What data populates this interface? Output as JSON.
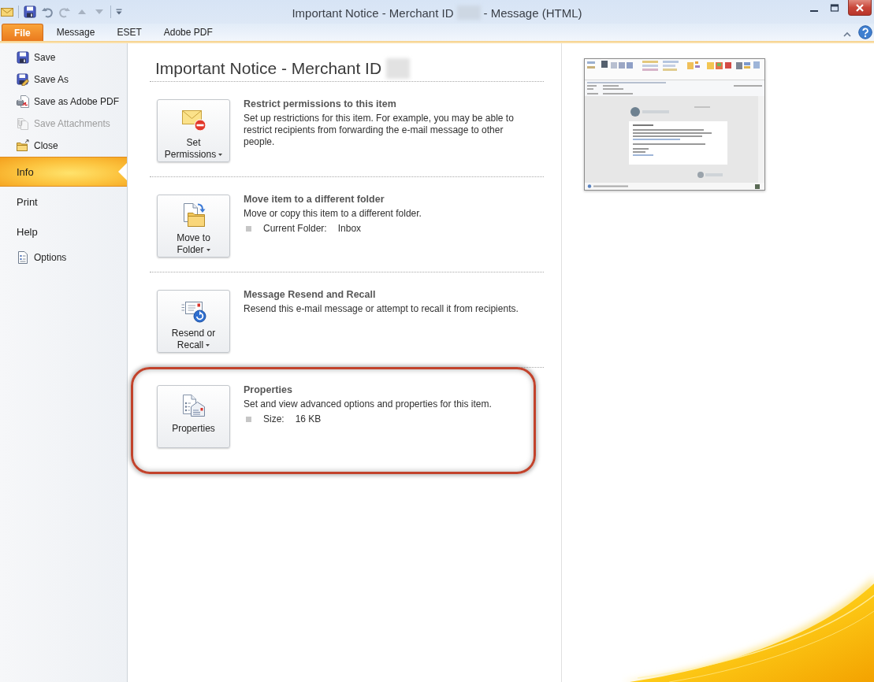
{
  "window": {
    "title_start": "Important Notice - Merchant ID",
    "id_redacted": true,
    "title_end": "- Message (HTML)"
  },
  "ribbon_tabs": [
    {
      "label": "File",
      "selected": true
    },
    {
      "label": "Message",
      "selected": false
    },
    {
      "label": "ESET",
      "selected": false
    },
    {
      "label": "Adobe PDF",
      "selected": false
    }
  ],
  "backstage_nav": [
    {
      "kind": "command",
      "label": "Save",
      "selected": false,
      "disabled": false
    },
    {
      "kind": "command",
      "label": "Save As",
      "selected": false,
      "disabled": false
    },
    {
      "kind": "command",
      "label": "Save as Adobe PDF",
      "selected": false,
      "disabled": false
    },
    {
      "kind": "command",
      "label": "Save Attachments",
      "selected": false,
      "disabled": true
    },
    {
      "kind": "command",
      "label": "Close",
      "selected": false,
      "disabled": false
    },
    {
      "kind": "tab",
      "label": "Info",
      "selected": true,
      "disabled": false
    },
    {
      "kind": "tab",
      "label": "Print",
      "selected": false,
      "disabled": false
    },
    {
      "kind": "tab",
      "label": "Help",
      "selected": false,
      "disabled": false
    },
    {
      "kind": "command",
      "label": "Options",
      "selected": false,
      "disabled": false
    }
  ],
  "info": {
    "title": "Important Notice - Merchant ID",
    "id_redacted": true,
    "sections": [
      {
        "heading": "Restrict permissions to this item",
        "description": "Set up restrictions for this item. For example, you may be able to restrict recipients from forwarding the e-mail message to other people.",
        "button": {
          "label": "Set Permissions",
          "dropdown": true
        },
        "highlighted": false
      },
      {
        "heading": "Move item to a different folder",
        "description": "Move or copy this item to a different folder.",
        "button": {
          "label": "Move to Folder",
          "dropdown": true
        },
        "details": [
          {
            "label": "Current Folder:",
            "value": "Inbox"
          }
        ],
        "highlighted": false
      },
      {
        "heading": "Message Resend and Recall",
        "description": "Resend this e-mail message or attempt to recall it from recipients.",
        "button": {
          "label": "Resend or Recall",
          "dropdown": true
        },
        "highlighted": false
      },
      {
        "heading": "Properties",
        "description": "Set and view advanced options and properties for this item.",
        "button": {
          "label": "Properties",
          "dropdown": false
        },
        "details": [
          {
            "label": "Size:",
            "value": "16 KB"
          }
        ],
        "highlighted": true
      }
    ]
  }
}
